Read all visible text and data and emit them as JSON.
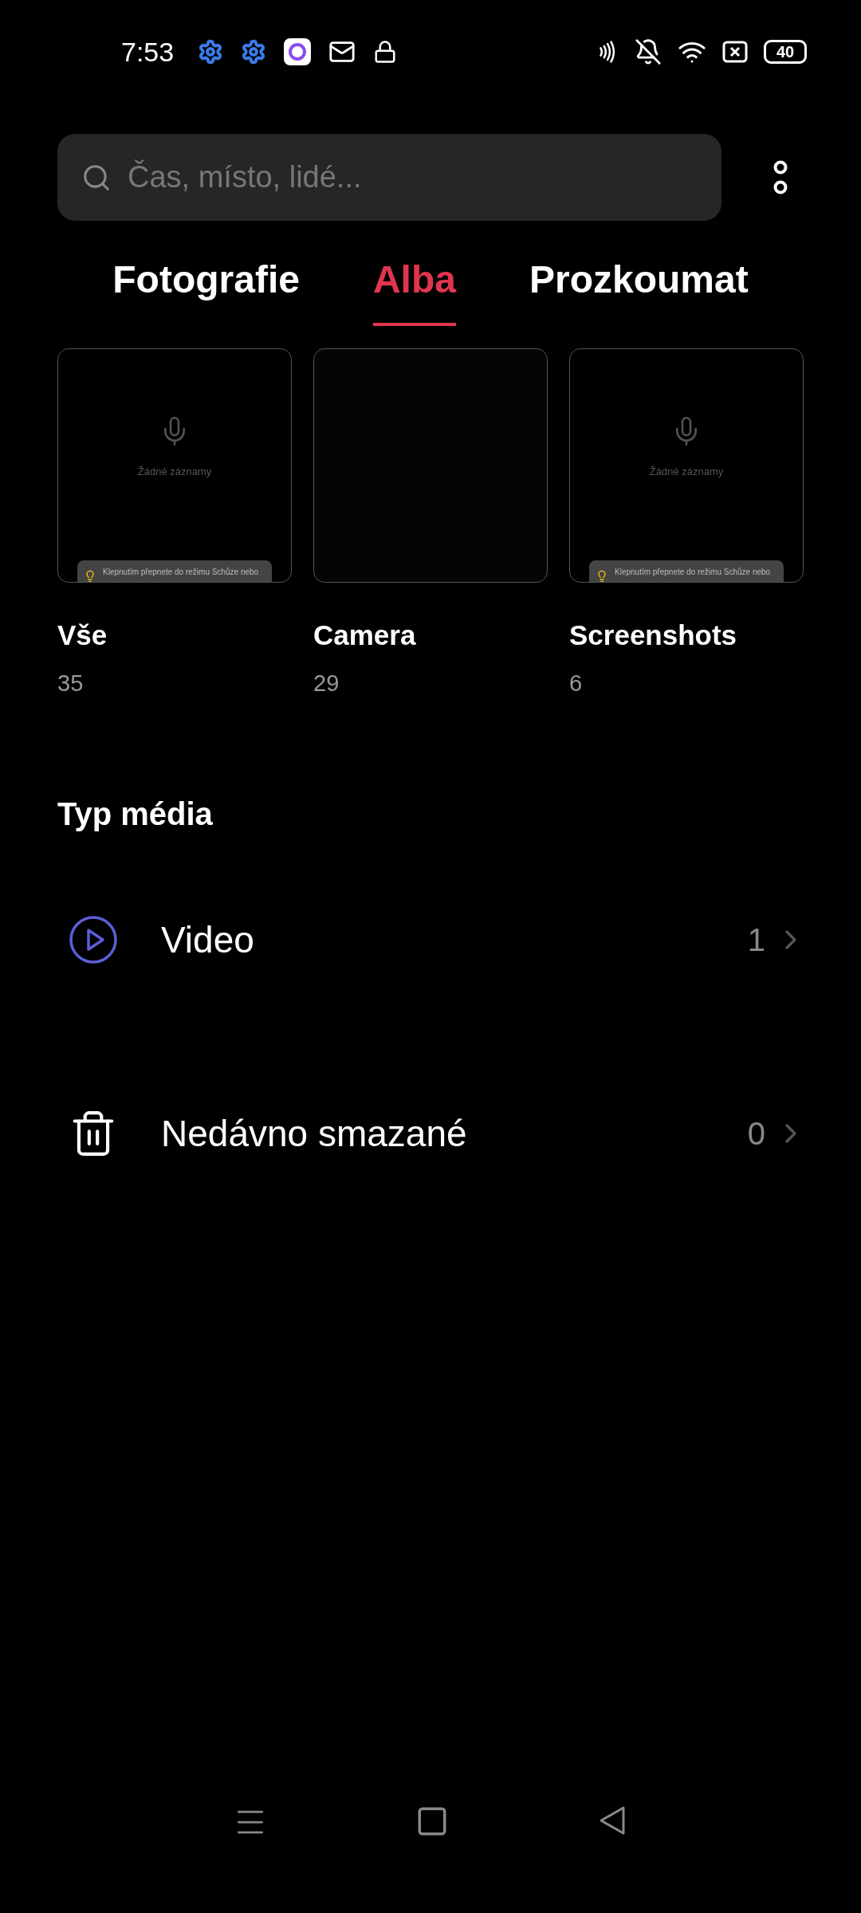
{
  "status_bar": {
    "time": "7:53",
    "battery": "40"
  },
  "search": {
    "placeholder": "Čas, místo, lidé..."
  },
  "tabs": [
    {
      "label": "Fotografie",
      "selected": false
    },
    {
      "label": "Alba",
      "selected": true
    },
    {
      "label": "Prozkoumat",
      "selected": false
    }
  ],
  "albums": [
    {
      "name": "Vše",
      "count": "35",
      "thumbnail": {
        "kind": "recorder",
        "empty_text": "Žádné záznamy",
        "tip": "Klepnutím přepnete do režimu Schůze nebo"
      }
    },
    {
      "name": "Camera",
      "count": "29",
      "thumbnail": {
        "kind": "dark"
      }
    },
    {
      "name": "Screenshots",
      "count": "6",
      "thumbnail": {
        "kind": "recorder",
        "empty_text": "Žádné záznamy",
        "tip": "Klepnutím přepnete do režimu Schůze nebo"
      }
    }
  ],
  "media_section": {
    "title": "Typ média",
    "items": [
      {
        "kind": "video",
        "label": "Video",
        "count": "1"
      },
      {
        "kind": "trash",
        "label": "Nedávno smazané",
        "count": "0"
      }
    ]
  }
}
